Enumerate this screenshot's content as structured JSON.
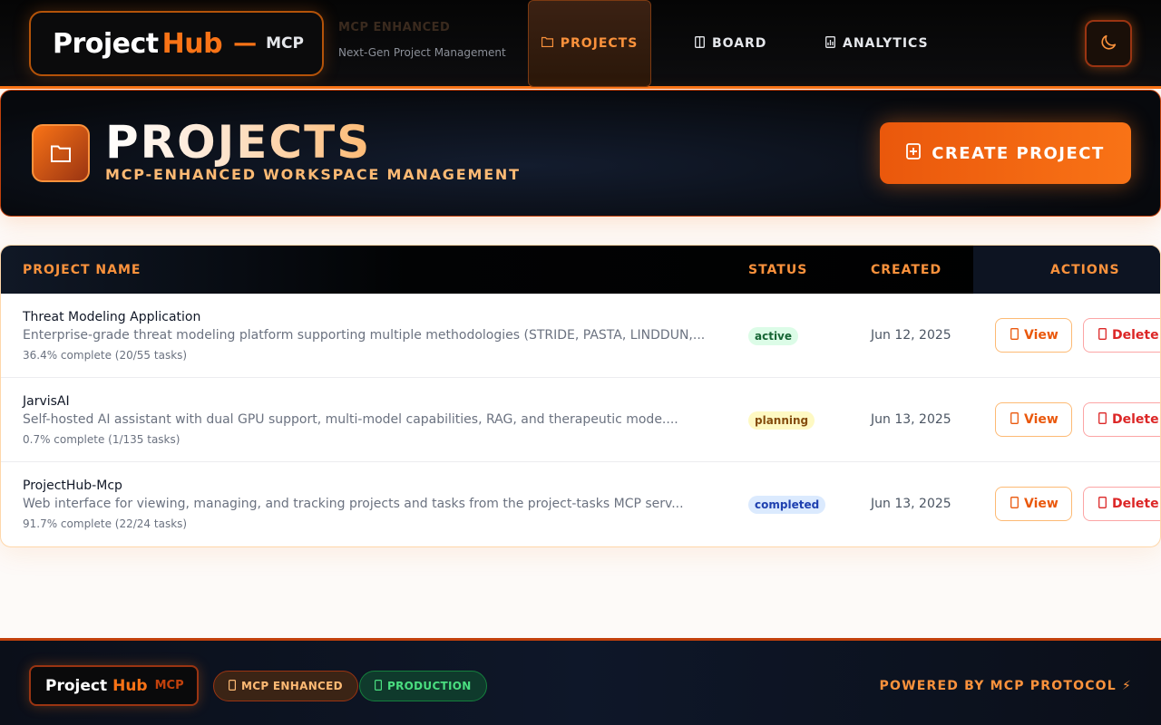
{
  "header": {
    "logo": {
      "project": "Project",
      "hub": "Hub",
      "dash": "—",
      "mcp": "MCP"
    },
    "tagline_top": "MCP ENHANCED",
    "tagline_bottom": "Next-Gen Project Management",
    "nav": [
      {
        "label": "PROJECTS",
        "icon": "folder-icon",
        "active": true
      },
      {
        "label": "BOARD",
        "icon": "board-icon",
        "active": false
      },
      {
        "label": "ANALYTICS",
        "icon": "analytics-icon",
        "active": false
      }
    ],
    "theme_toggle_icon": "moon-icon"
  },
  "hero": {
    "icon": "folder-icon",
    "title": "PROJECTS",
    "subtitle": "MCP-ENHANCED WORKSPACE MANAGEMENT",
    "create_button": {
      "label": "CREATE PROJECT",
      "icon": "plus-icon"
    }
  },
  "table": {
    "columns": [
      "PROJECT NAME",
      "STATUS",
      "CREATED",
      "ACTIONS"
    ],
    "rows": [
      {
        "name": "Threat Modeling Application",
        "description": "Enterprise-grade threat modeling platform supporting multiple methodologies (STRIDE, PASTA, LINDDUN,...",
        "progress": "36.4% complete (20/55 tasks)",
        "status": "active",
        "created": "Jun 12, 2025",
        "view_label": "View",
        "delete_label": "Delete"
      },
      {
        "name": "JarvisAI",
        "description": "Self-hosted AI assistant with dual GPU support, multi-model capabilities, RAG, and therapeutic mode....",
        "progress": "0.7% complete (1/135 tasks)",
        "status": "planning",
        "created": "Jun 13, 2025",
        "view_label": "View",
        "delete_label": "Delete"
      },
      {
        "name": "ProjectHub-Mcp",
        "description": "Web interface for viewing, managing, and tracking projects and tasks from the project-tasks MCP serv...",
        "progress": "91.7% complete (22/24 tasks)",
        "status": "completed",
        "created": "Jun 13, 2025",
        "view_label": "View",
        "delete_label": "Delete"
      }
    ]
  },
  "footer": {
    "logo": {
      "project": "Project",
      "hub": "Hub",
      "mcp": "MCP"
    },
    "badges": [
      {
        "label": "MCP ENHANCED",
        "icon": "sparkle-icon"
      },
      {
        "label": "PRODUCTION",
        "icon": "check-icon"
      }
    ],
    "powered_by": "POWERED BY MCP PROTOCOL ⚡"
  },
  "colors": {
    "accent": "#f97316",
    "header_bg": "#050505",
    "status_active": "#166534",
    "status_planning": "#854d0e",
    "status_completed": "#1e40af",
    "delete": "#dc2626"
  }
}
